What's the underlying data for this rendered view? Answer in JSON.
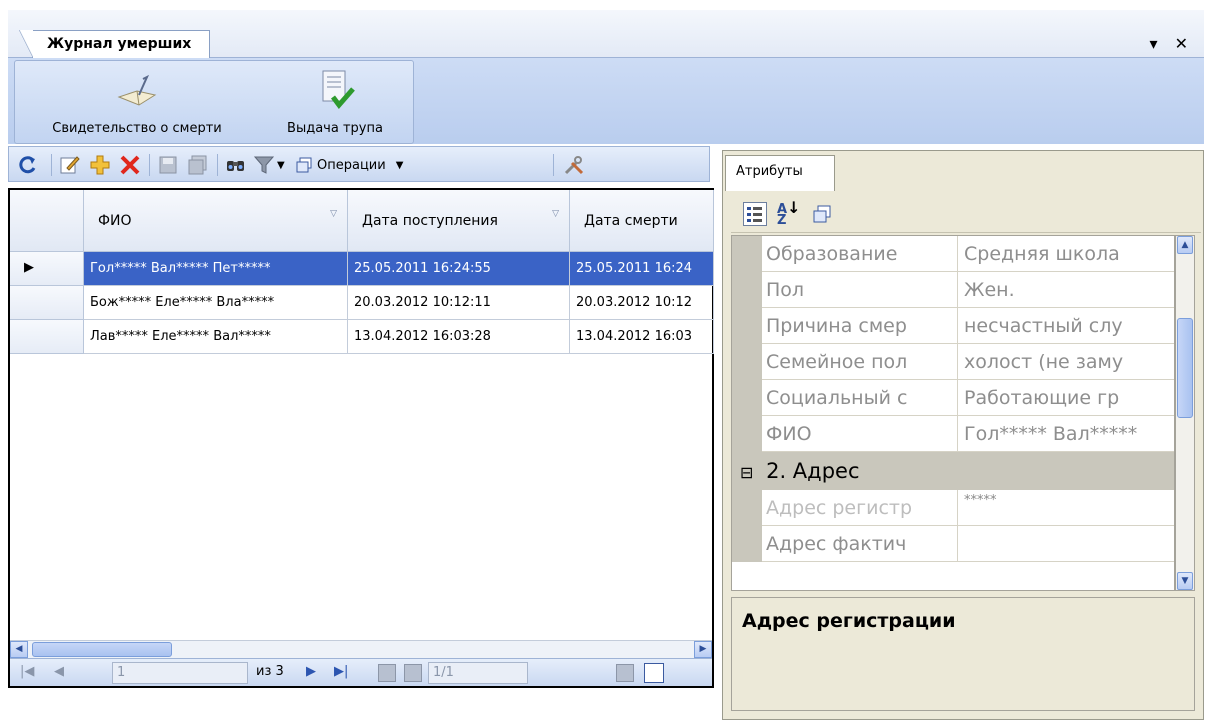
{
  "document_tab": {
    "title": "Журнал умерших",
    "controls": "▾ ✕"
  },
  "ribbon": {
    "buttons": [
      {
        "label": "Свидетельство о смерти",
        "icon": "open-book-icon"
      },
      {
        "label": "Выдача трупа",
        "icon": "document-checkmark-icon"
      }
    ]
  },
  "grid_toolbar": {
    "operations_label": "Операции",
    "icons": [
      "refresh-icon",
      "edit-icon",
      "add-icon",
      "delete-icon",
      "save-icon",
      "save-all-icon",
      "find-icon",
      "filter-icon",
      "copy-icon",
      "tools-icon"
    ]
  },
  "grid": {
    "columns": [
      "ФИО",
      "Дата поступления",
      "Дата смерти"
    ],
    "rows": [
      {
        "fio": "Гол***** Вал***** Пет*****",
        "admitted": "25.05.2011 16:24:55",
        "death": "25.05.2011 16:24"
      },
      {
        "fio": "Бож***** Еле***** Вла*****",
        "admitted": "20.03.2012 10:12:11",
        "death": "20.03.2012 10:12"
      },
      {
        "fio": "Лав***** Еле***** Вал*****",
        "admitted": "13.04.2012 16:03:28",
        "death": "13.04.2012 16:03"
      }
    ],
    "selected_row": 0
  },
  "pager": {
    "page_input": "1",
    "of_label": "из 3",
    "record_label": "1/1"
  },
  "attributes_panel": {
    "tab_label": "Атрибуты",
    "properties": [
      {
        "key": "Образование",
        "value": "Средняя школа"
      },
      {
        "key": "Пол",
        "value": "Жен."
      },
      {
        "key": "Причина смер",
        "value": "несчастный слу"
      },
      {
        "key": "Семейное пол",
        "value": "холост (не заму"
      },
      {
        "key": "Социальный с",
        "value": "Работающие гр"
      },
      {
        "key": "ФИО",
        "value": "Гол***** Вал*****"
      }
    ],
    "category": {
      "toggle": "⊟",
      "label": "2. Адрес"
    },
    "address_properties": [
      {
        "key": "Адрес регистр",
        "value": "*****"
      },
      {
        "key": "Адрес фактич",
        "value": ""
      }
    ],
    "description_title": "Адрес регистрации"
  }
}
